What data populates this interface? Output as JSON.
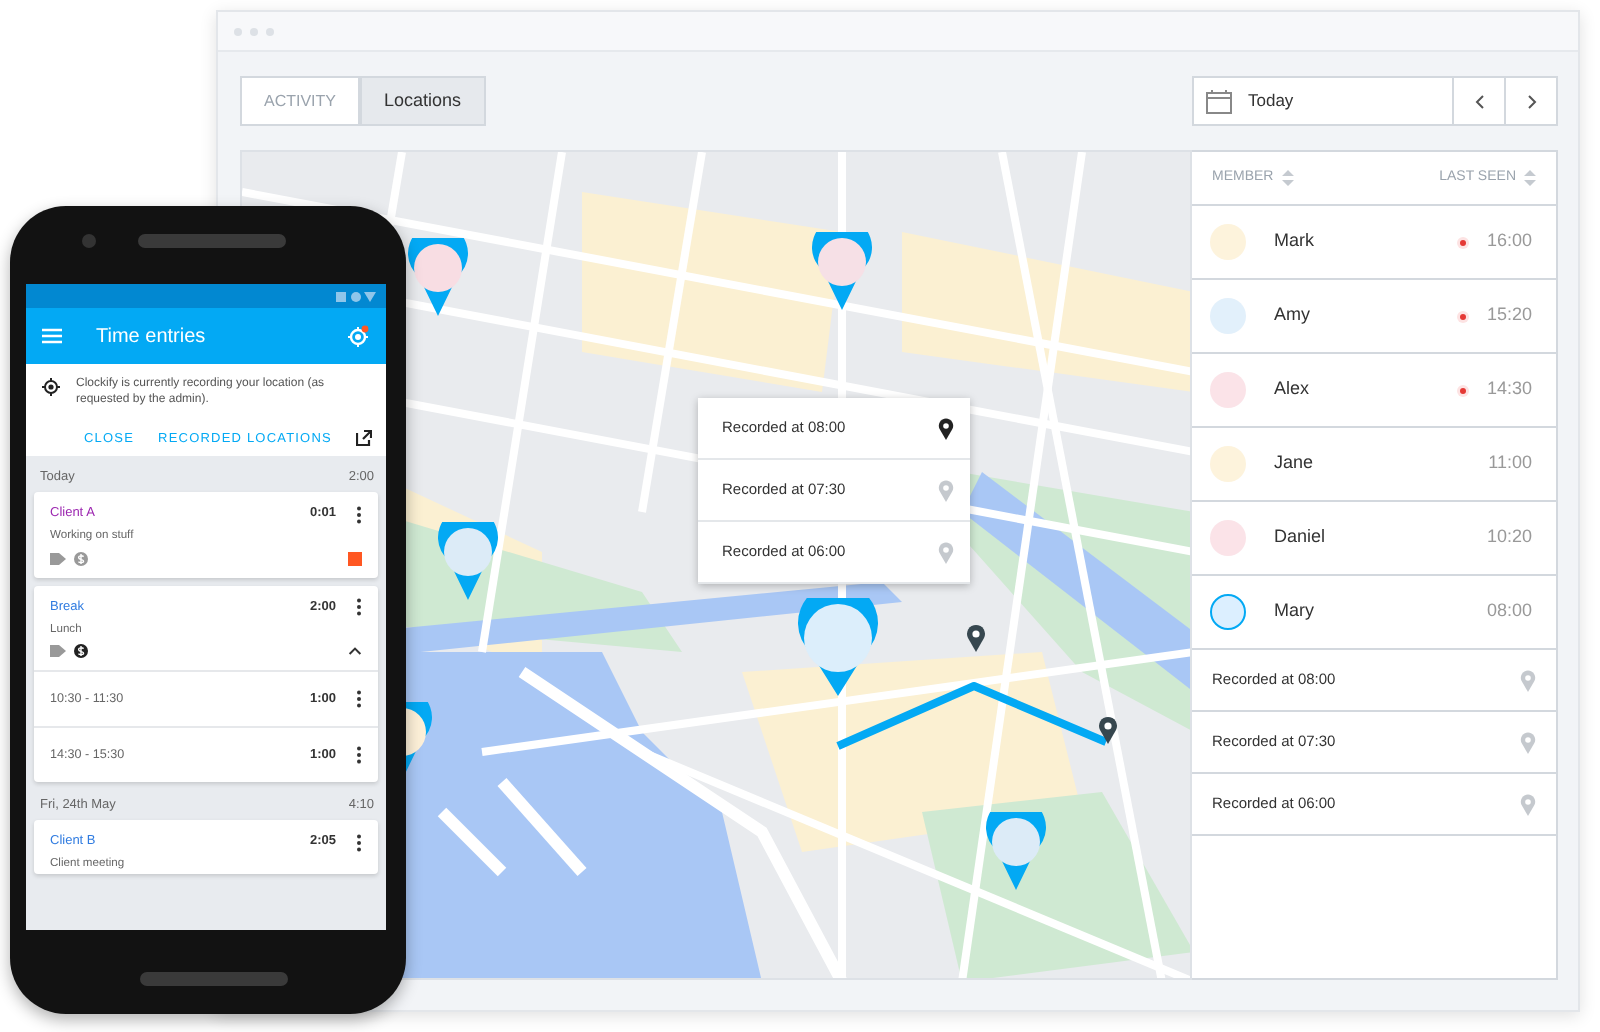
{
  "browser": {
    "tabs": [
      {
        "label": "ACTIVITY",
        "selected": false
      },
      {
        "label": "Locations",
        "selected": true
      }
    ],
    "date_picker": {
      "label": "Today"
    }
  },
  "map": {
    "popup_rows": [
      {
        "label": "Recorded at 08:00",
        "selected": true
      },
      {
        "label": "Recorded at 07:30",
        "selected": false
      },
      {
        "label": "Recorded at 06:00",
        "selected": false
      }
    ]
  },
  "members_panel": {
    "columns": [
      "MEMBER",
      "LAST SEEN"
    ],
    "members": [
      {
        "name": "Mark",
        "last_seen": "16:00",
        "recording": true,
        "selected": false
      },
      {
        "name": "Amy",
        "last_seen": "15:20",
        "recording": true,
        "selected": false
      },
      {
        "name": "Alex",
        "last_seen": "14:30",
        "recording": true,
        "selected": false
      },
      {
        "name": "Jane",
        "last_seen": "11:00",
        "recording": false,
        "selected": false
      },
      {
        "name": "Daniel",
        "last_seen": "10:20",
        "recording": false,
        "selected": false
      },
      {
        "name": "Mary",
        "last_seen": "08:00",
        "recording": false,
        "selected": true
      }
    ],
    "recorded": [
      {
        "label": "Recorded at 08:00",
        "selected": false
      },
      {
        "label": "Recorded at 07:30",
        "selected": false
      },
      {
        "label": "Recorded at 06:00",
        "selected": false
      }
    ]
  },
  "phone": {
    "title": "Time entries",
    "notice": "Clockify is currently recording your location (as requested by the admin).",
    "actions": [
      "CLOSE",
      "RECORDED LOCATIONS"
    ],
    "days": [
      {
        "label": "Today",
        "total": "2:00",
        "entries": [
          {
            "project": "Client A",
            "color": "#9c27b0",
            "description": "Working on stuff",
            "duration": "0:01",
            "billable": false,
            "running": true,
            "expanded": false
          },
          {
            "project": "Break",
            "color": "#2f7be0",
            "description": "Lunch",
            "duration": "2:00",
            "billable": true,
            "running": false,
            "expanded": true,
            "children": [
              {
                "range": "10:30 - 11:30",
                "duration": "1:00"
              },
              {
                "range": "14:30 - 15:30",
                "duration": "1:00"
              }
            ]
          }
        ]
      },
      {
        "label": "Fri, 24th May",
        "total": "4:10",
        "entries": [
          {
            "project": "Client B",
            "color": "#2f7be0",
            "description": "Client meeting",
            "duration": "2:05"
          }
        ]
      }
    ]
  }
}
